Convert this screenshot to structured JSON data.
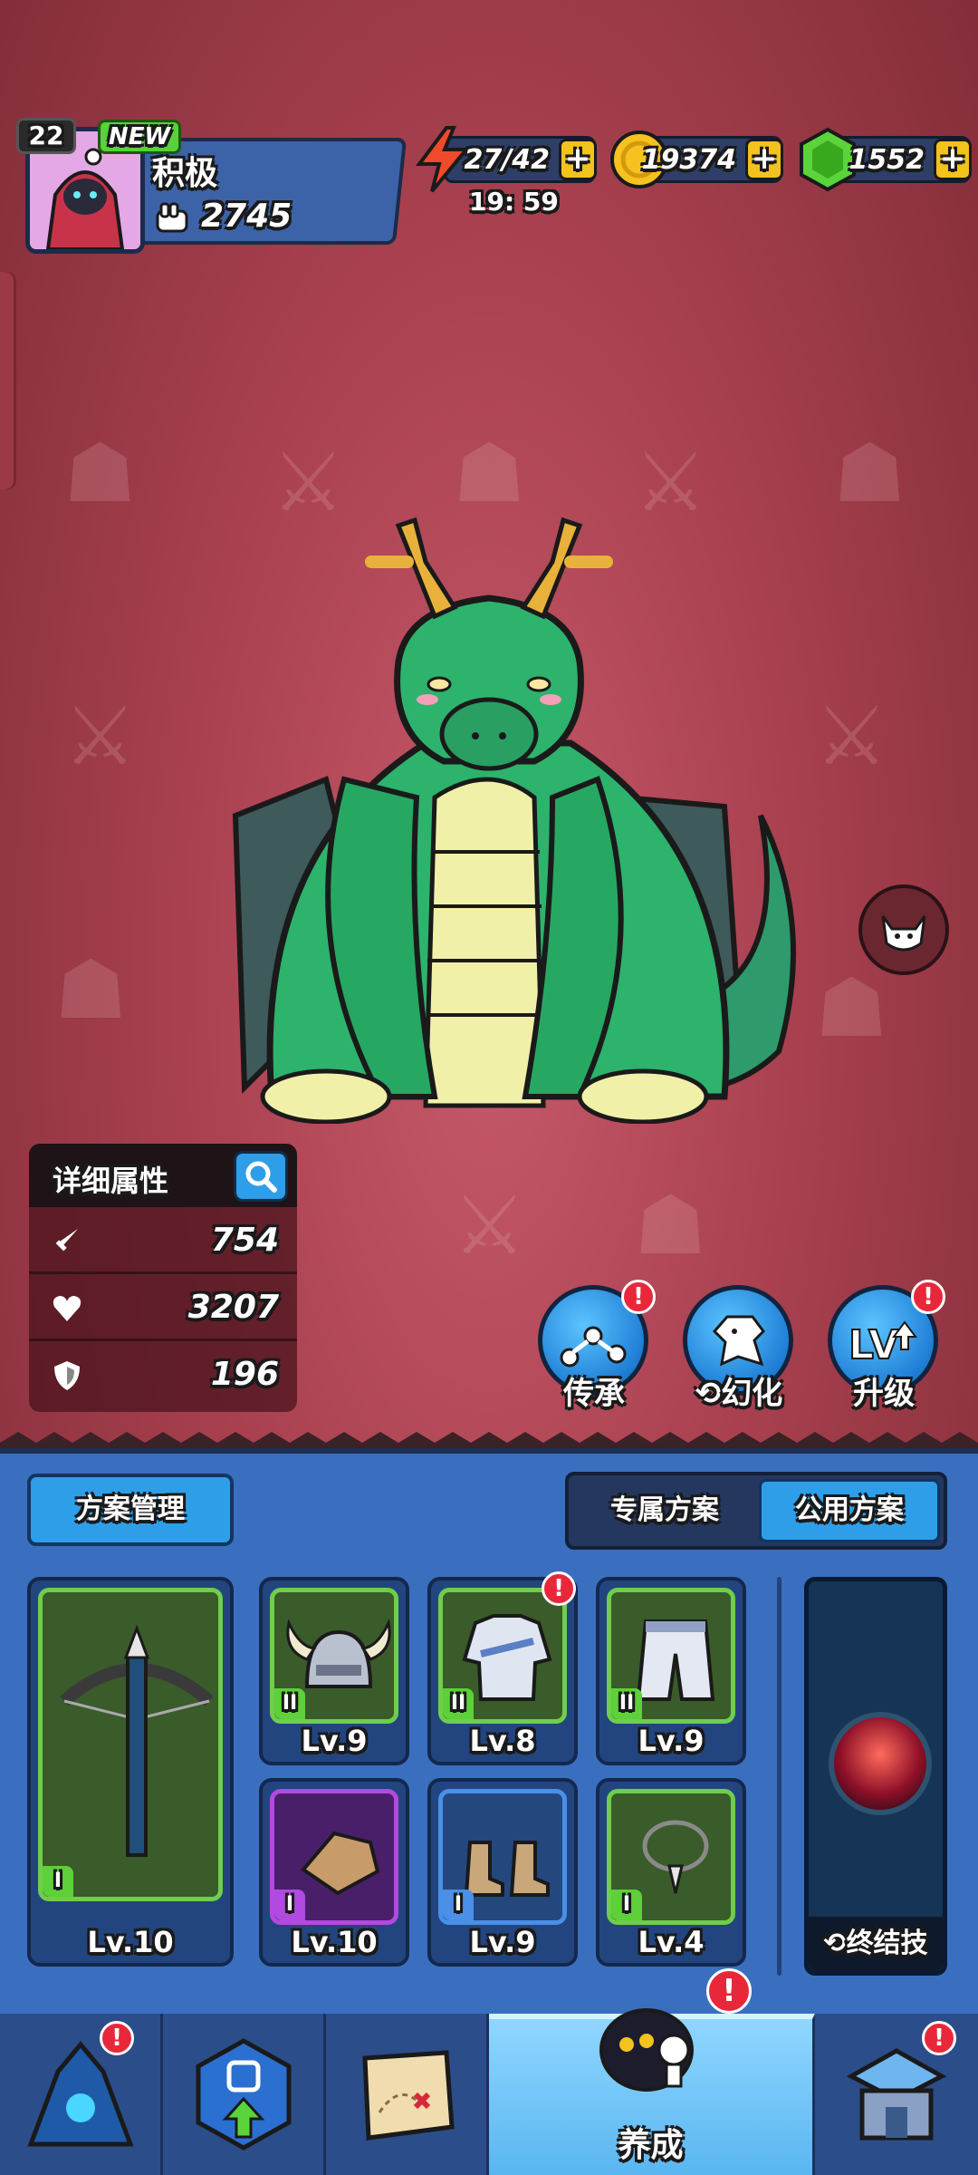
{
  "player": {
    "level": "22",
    "new_badge": "NEW",
    "name": "积极",
    "power": "2745"
  },
  "resources": {
    "energy": "27/42",
    "energy_timer": "19: 59",
    "gold": "19374",
    "gems": "1552",
    "plus": "+"
  },
  "stats": {
    "title": "详细属性",
    "attack": "754",
    "health": "3207",
    "defense": "196"
  },
  "actions": {
    "inherit": "传承",
    "transform": "幻化",
    "upgrade": "升级",
    "alert": "!"
  },
  "plan": {
    "manage": "方案管理",
    "exclusive": "专属方案",
    "public": "公用方案"
  },
  "equipment": {
    "weapon": {
      "tier": "I",
      "level": "Lv.10"
    },
    "helmet": {
      "tier": "II",
      "level": "Lv.9"
    },
    "armor": {
      "tier": "II",
      "level": "Lv.8"
    },
    "pants": {
      "tier": "II",
      "level": "Lv.9"
    },
    "gloves": {
      "tier": "I",
      "level": "Lv.10"
    },
    "boots": {
      "tier": "I",
      "level": "Lv.9"
    },
    "necklace": {
      "tier": "I",
      "level": "Lv.4"
    }
  },
  "ultimate": {
    "label": "终结技"
  },
  "nav": {
    "active_label": "养成"
  },
  "colors": {
    "accent_blue": "#2f9ee8",
    "panel_blue": "#3a6fc0",
    "alert_red": "#e8283a",
    "green_frame": "#6fce4c",
    "purple_frame": "#b14ae0",
    "blue_frame": "#4a8fe8"
  }
}
